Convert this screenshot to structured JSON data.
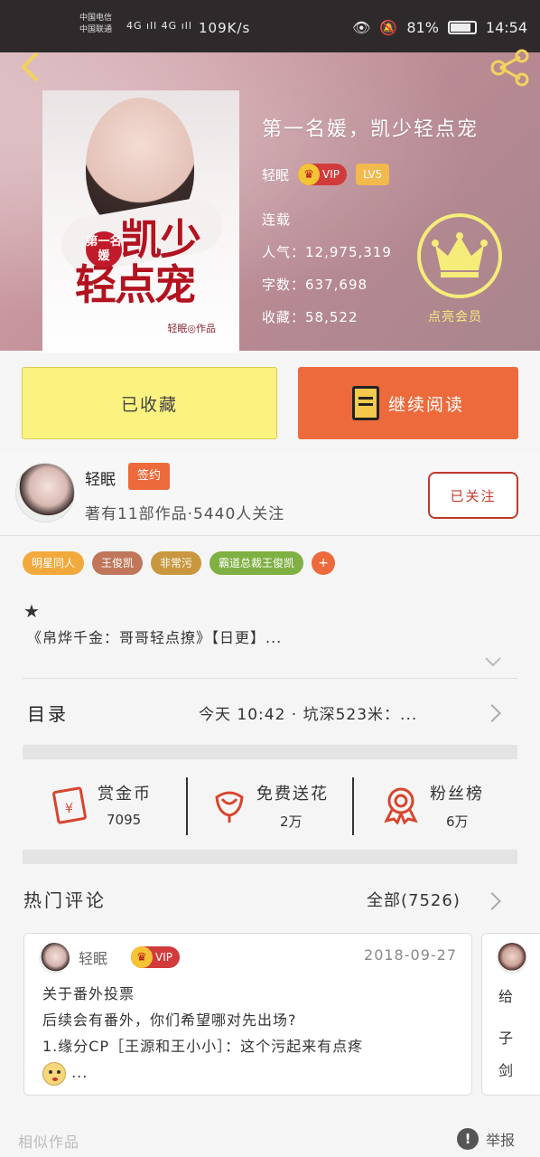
{
  "status_bar": {
    "carrier1": "中国电信",
    "carrier2": "中国联通",
    "signal": "4G ıll 4G ıll",
    "speed": "109K/s",
    "battery": "81%",
    "time": "14:54"
  },
  "book": {
    "title": "第一名媛，凯少轻点宠",
    "author": "轻眠",
    "vip_label": "VIP",
    "level": "LV5",
    "status": "连载",
    "popularity": "人气：12,975,319",
    "word_count": "字数：637,698",
    "favorites": "收藏：58,522",
    "vip_action": "点亮会员",
    "cover": {
      "badge": "第一名媛",
      "line1": "凯少",
      "line2": "轻点宠",
      "author_line": "轻眠◎作品"
    }
  },
  "buttons": {
    "collected": "已收藏",
    "continue_read": "继续阅读"
  },
  "author_section": {
    "name": "轻眠",
    "sign_badge": "签约",
    "stats": "著有11部作品·5440人关注",
    "follow": "已关注"
  },
  "tags": [
    {
      "label": "明星同人",
      "color": "#f2a93b"
    },
    {
      "label": "王俊凯",
      "color": "#c0765a"
    },
    {
      "label": "非常污",
      "color": "#c9973f"
    },
    {
      "label": "霸道总裁王俊凯",
      "color": "#7fb043"
    }
  ],
  "tag_more": "+",
  "synopsis": "《帛烨千金：哥哥轻点撩》【日更】...",
  "toc": {
    "label": "目录",
    "latest": "今天 10:42 · 坑深523米：..."
  },
  "actions": [
    {
      "title": "赏金币",
      "value": "7095"
    },
    {
      "title": "免费送花",
      "value": "2万"
    },
    {
      "title": "粉丝榜",
      "value": "6万"
    }
  ],
  "comments": {
    "title": "热门评论",
    "all": "全部(7526)",
    "items": [
      {
        "user": "轻眠",
        "vip": "VIP",
        "date": "2018-09-27",
        "lines": [
          "关于番外投票",
          "后续会有番外，你们希望哪对先出场?",
          "1.缘分CP［王源和王小小］：这个污起来有点疼"
        ],
        "tail": "..."
      }
    ],
    "partial": [
      "给",
      "子",
      "剑"
    ]
  },
  "footer": {
    "left": "相似作品",
    "report": "举报",
    "report_icon": "!"
  },
  "colors": {
    "accent": "#ec6a3b",
    "collect_button": "#fbf280",
    "vip_yellow": "#f6ec7a",
    "follow_red": "#c0392b"
  }
}
